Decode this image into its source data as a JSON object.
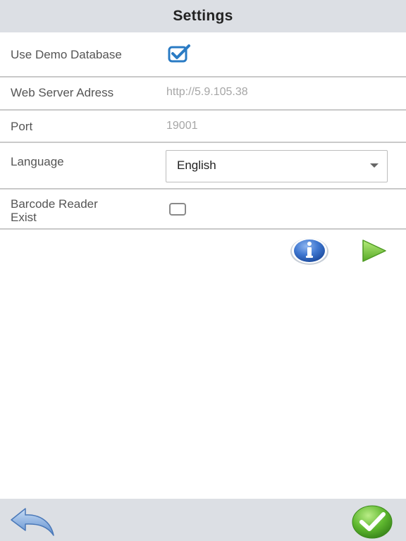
{
  "header": {
    "title": "Settings"
  },
  "settings": {
    "demo_db": {
      "label": "Use Demo Database",
      "checked": true
    },
    "web_server": {
      "label": "Web Server Adress",
      "value": "http://5.9.105.38"
    },
    "port": {
      "label": "Port",
      "value": "19001"
    },
    "language": {
      "label": "Language",
      "selected": "English"
    },
    "barcode": {
      "label_line1": "Barcode Reader",
      "label_line2": "Exist",
      "checked": false
    }
  },
  "actions": {
    "info_icon": "info-icon",
    "play_icon": "play-icon"
  },
  "footer": {
    "back_icon": "back-arrow-icon",
    "confirm_icon": "checkmark-icon"
  },
  "colors": {
    "header_bg": "#dcdfe4",
    "checkbox_blue": "#2a7bc4",
    "info_blue": "#2e66c4",
    "play_green": "#7ccf3a",
    "confirm_green": "#5fb82f"
  }
}
